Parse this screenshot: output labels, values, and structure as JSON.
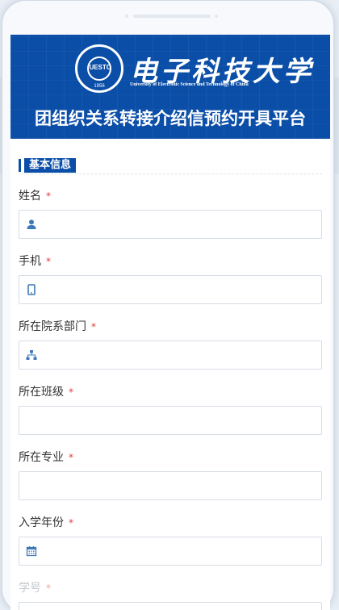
{
  "banner": {
    "university_cn": "电子科技大学",
    "university_en": "University of Electronic Science and Technology of China",
    "logo_text": "UESTC",
    "logo_year": "1956",
    "platform_title": "团组织关系转接介绍信预约开具平台"
  },
  "section": {
    "title": "基本信息"
  },
  "fields": [
    {
      "label": "姓名",
      "required": "*",
      "icon": "user-icon",
      "value": ""
    },
    {
      "label": "手机",
      "required": "*",
      "icon": "mobile-icon",
      "value": ""
    },
    {
      "label": "所在院系部门",
      "required": "*",
      "icon": "org-chart-icon",
      "value": ""
    },
    {
      "label": "所在班级",
      "required": "*",
      "icon": "",
      "value": ""
    },
    {
      "label": "所在专业",
      "required": "*",
      "icon": "",
      "value": ""
    },
    {
      "label": "入学年份",
      "required": "*",
      "icon": "calendar-icon",
      "value": ""
    },
    {
      "label": "学号",
      "required": "*",
      "icon": "",
      "value": ""
    }
  ],
  "colors": {
    "brand_blue": "#0a4ea8",
    "required_red": "#e23b3b",
    "icon_blue": "#3f78b8"
  }
}
